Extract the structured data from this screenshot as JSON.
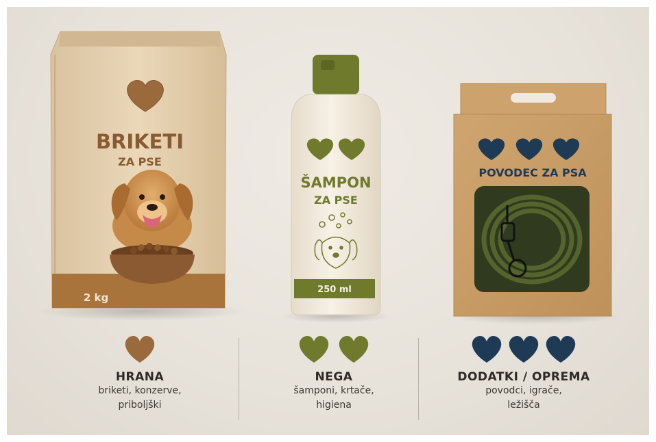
{
  "products": {
    "food": {
      "title": "BRIKETI",
      "subtitle": "ZA PSE",
      "weight": "2 kg"
    },
    "shampoo": {
      "title": "ŠAMPON",
      "subtitle": "ZA PSE",
      "volume": "250 ml"
    },
    "leash": {
      "title": "POVODEC ZA PSA"
    }
  },
  "categories": [
    {
      "title": "HRANA",
      "desc1": "briketi, konzerve,",
      "desc2": "priboljški",
      "hearts": 1,
      "color": "#9b6a3c"
    },
    {
      "title": "NEGA",
      "desc1": "šamponi, krtače,",
      "desc2": "higiena",
      "hearts": 2,
      "color": "#6f7a2c"
    },
    {
      "title": "DODATKI / OPREMA",
      "desc1": "povodci, igrače,",
      "desc2": "ležišča",
      "hearts": 3,
      "color": "#1f3a55"
    }
  ],
  "colors": {
    "brown": "#9b6a3c",
    "olive": "#6f7a2c",
    "navy": "#1f3a55",
    "kraft": "#c9a06a"
  }
}
